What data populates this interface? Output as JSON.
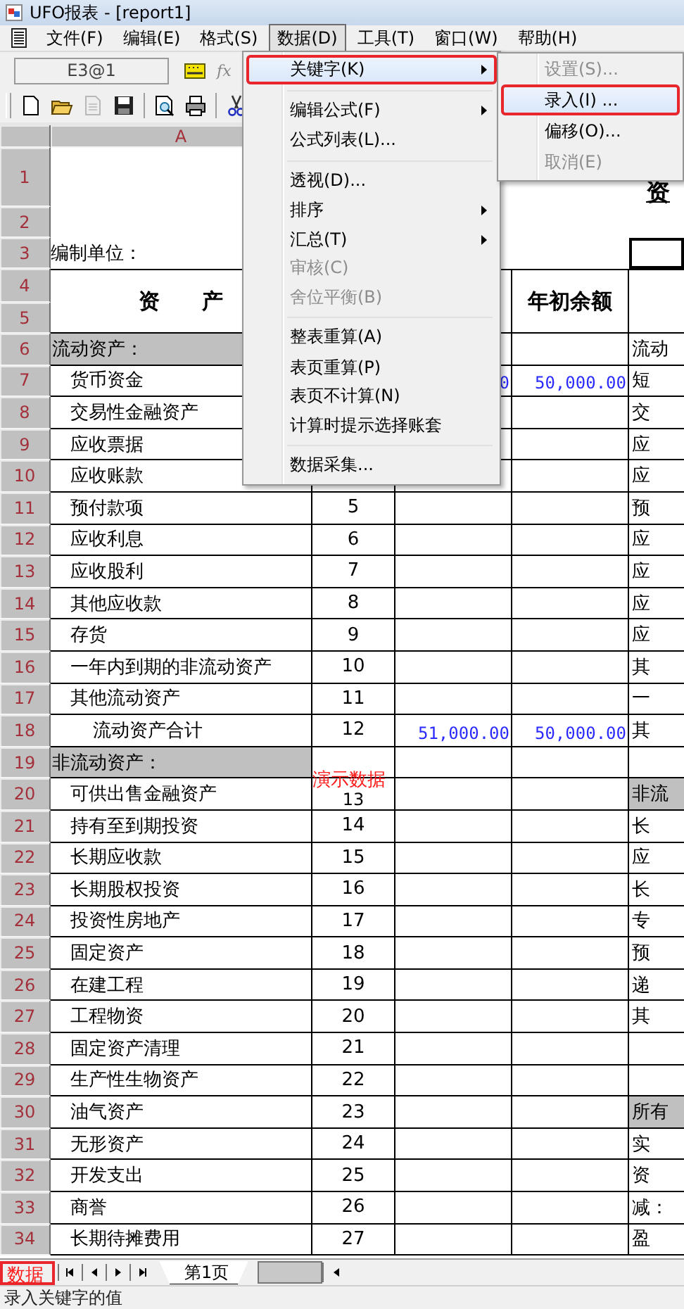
{
  "window": {
    "title": "UFO报表 - [report1]"
  },
  "menu_bar": [
    {
      "label": "文件(F)",
      "selected": false
    },
    {
      "label": "编辑(E)",
      "selected": false
    },
    {
      "label": "格式(S)",
      "selected": false
    },
    {
      "label": "数据(D)",
      "selected": true
    },
    {
      "label": "工具(T)",
      "selected": false
    },
    {
      "label": "窗口(W)",
      "selected": false
    },
    {
      "label": "帮助(H)",
      "selected": false
    }
  ],
  "formula_bar": {
    "cell_ref": "E3@1",
    "fx_label": "fx"
  },
  "column_headers": [
    "A"
  ],
  "row_numbers": [
    "1",
    "2",
    "3",
    "4",
    "5",
    "6",
    "7",
    "8",
    "9",
    "10",
    "11",
    "12",
    "13",
    "14",
    "15",
    "16",
    "17",
    "18",
    "19",
    "20",
    "21",
    "22",
    "23",
    "24",
    "25",
    "26",
    "27",
    "28",
    "29",
    "30",
    "31",
    "32",
    "33",
    "34"
  ],
  "sheet": {
    "title_fragment": "资",
    "unit_label": "编制单位：",
    "asset_header": "资　　产",
    "opening_header": "年初余额",
    "e3_cell": {
      "selected": true
    },
    "rows": [
      {
        "kind": "section",
        "item": "流动资产：",
        "right": "流动",
        "right_section": false
      },
      {
        "kind": "item",
        "item": "货币资金",
        "current": "0",
        "opening": "50,000.00",
        "right": "短",
        "right_section": false
      },
      {
        "kind": "item",
        "item": "交易性金融资产",
        "right": "交",
        "right_section": false
      },
      {
        "kind": "item",
        "item": "应收票据",
        "right": "应",
        "right_section": false
      },
      {
        "kind": "item",
        "item": "应收账款",
        "right": "应",
        "right_section": false
      },
      {
        "kind": "item",
        "item": "预付款项",
        "line": "5",
        "right": "预",
        "right_section": false
      },
      {
        "kind": "item",
        "item": "应收利息",
        "line": "6",
        "right": "应",
        "right_section": false
      },
      {
        "kind": "item",
        "item": "应收股利",
        "line": "7",
        "right": "应",
        "right_section": false
      },
      {
        "kind": "item",
        "item": "其他应收款",
        "line": "8",
        "right": "应",
        "right_section": false
      },
      {
        "kind": "item",
        "item": "存货",
        "line": "9",
        "right": "应",
        "right_section": false
      },
      {
        "kind": "item",
        "item": "一年内到期的非流动资产",
        "line": "10",
        "right": "其",
        "right_section": false
      },
      {
        "kind": "item",
        "item": "其他流动资产",
        "line": "11",
        "right": "一",
        "right_section": false
      },
      {
        "kind": "total",
        "item": "流动资产合计",
        "line": "12",
        "current": "51,000.00",
        "opening": "50,000.00",
        "right": "其",
        "right_section": false
      },
      {
        "kind": "section",
        "item": "非流动资产：",
        "right_section": false
      },
      {
        "kind": "item",
        "item": "可供出售金融资产",
        "line": "13",
        "overlay": "演示数据",
        "right": "非流",
        "right_section": true
      },
      {
        "kind": "item",
        "item": "持有至到期投资",
        "line": "14",
        "right": "长",
        "right_section": false
      },
      {
        "kind": "item",
        "item": "长期应收款",
        "line": "15",
        "right": "应",
        "right_section": false
      },
      {
        "kind": "item",
        "item": "长期股权投资",
        "line": "16",
        "right": "长",
        "right_section": false
      },
      {
        "kind": "item",
        "item": "投资性房地产",
        "line": "17",
        "right": "专",
        "right_section": false
      },
      {
        "kind": "item",
        "item": "固定资产",
        "line": "18",
        "right": "预",
        "right_section": false
      },
      {
        "kind": "item",
        "item": "在建工程",
        "line": "19",
        "right": "递",
        "right_section": false
      },
      {
        "kind": "item",
        "item": "工程物资",
        "line": "20",
        "right": "其",
        "right_section": false
      },
      {
        "kind": "item",
        "item": "固定资产清理",
        "line": "21",
        "right_section": false
      },
      {
        "kind": "item",
        "item": "生产性生物资产",
        "line": "22",
        "right_section": false
      },
      {
        "kind": "item",
        "item": "油气资产",
        "line": "23",
        "right": "所有",
        "right_section": true
      },
      {
        "kind": "item",
        "item": "无形资产",
        "line": "24",
        "right": "实",
        "right_section": false
      },
      {
        "kind": "item",
        "item": "开发支出",
        "line": "25",
        "right": "资",
        "right_section": false
      },
      {
        "kind": "item",
        "item": "商誉",
        "line": "26",
        "right": "减：",
        "right_section": false
      },
      {
        "kind": "item",
        "item": "长期待摊费用",
        "line": "27",
        "right": "盈",
        "right_section": false
      }
    ]
  },
  "data_menu": {
    "items": [
      {
        "label": "关键字(K)",
        "submenu": true,
        "selected": true,
        "disabled": false,
        "annotated": true,
        "separator_before": false
      },
      {
        "label": "编辑公式(F)",
        "submenu": true,
        "selected": false,
        "disabled": false,
        "annotated": false,
        "separator_before": true
      },
      {
        "label": "公式列表(L)...",
        "submenu": false,
        "selected": false,
        "disabled": false,
        "annotated": false,
        "separator_before": false
      },
      {
        "label": "透视(D)...",
        "submenu": false,
        "selected": false,
        "disabled": false,
        "annotated": false,
        "separator_before": true
      },
      {
        "label": "排序",
        "submenu": true,
        "selected": false,
        "disabled": false,
        "annotated": false,
        "separator_before": false
      },
      {
        "label": "汇总(T)",
        "submenu": true,
        "selected": false,
        "disabled": false,
        "annotated": false,
        "separator_before": false
      },
      {
        "label": "审核(C)",
        "submenu": false,
        "selected": false,
        "disabled": true,
        "annotated": false,
        "separator_before": false
      },
      {
        "label": "舍位平衡(B)",
        "submenu": false,
        "selected": false,
        "disabled": true,
        "annotated": false,
        "separator_before": false
      },
      {
        "label": "整表重算(A)",
        "submenu": false,
        "selected": false,
        "disabled": false,
        "annotated": false,
        "separator_before": true
      },
      {
        "label": "表页重算(P)",
        "submenu": false,
        "selected": false,
        "disabled": false,
        "annotated": false,
        "separator_before": false
      },
      {
        "label": "表页不计算(N)",
        "submenu": false,
        "selected": false,
        "disabled": false,
        "annotated": false,
        "separator_before": false
      },
      {
        "label": "计算时提示选择账套",
        "submenu": false,
        "selected": false,
        "disabled": false,
        "annotated": false,
        "separator_before": false
      },
      {
        "label": "数据采集...",
        "submenu": false,
        "selected": false,
        "disabled": false,
        "annotated": false,
        "separator_before": true
      }
    ]
  },
  "key_submenu": {
    "items": [
      {
        "label": "设置(S)...",
        "submenu": false,
        "selected": false,
        "disabled": true,
        "annotated": false,
        "separator_before": false
      },
      {
        "label": "录入(I) ...",
        "submenu": false,
        "selected": true,
        "disabled": false,
        "annotated": true,
        "separator_before": false
      },
      {
        "label": "偏移(O)...",
        "submenu": false,
        "selected": false,
        "disabled": false,
        "annotated": false,
        "separator_before": false
      },
      {
        "label": "取消(E)",
        "submenu": false,
        "selected": false,
        "disabled": true,
        "annotated": false,
        "separator_before": false
      }
    ]
  },
  "mode_label": {
    "text": "数据",
    "annotated": true
  },
  "sheet_tabs": [
    {
      "label": "第1页",
      "selected": true
    }
  ],
  "status_bar": {
    "text": "录入关键字的值"
  }
}
